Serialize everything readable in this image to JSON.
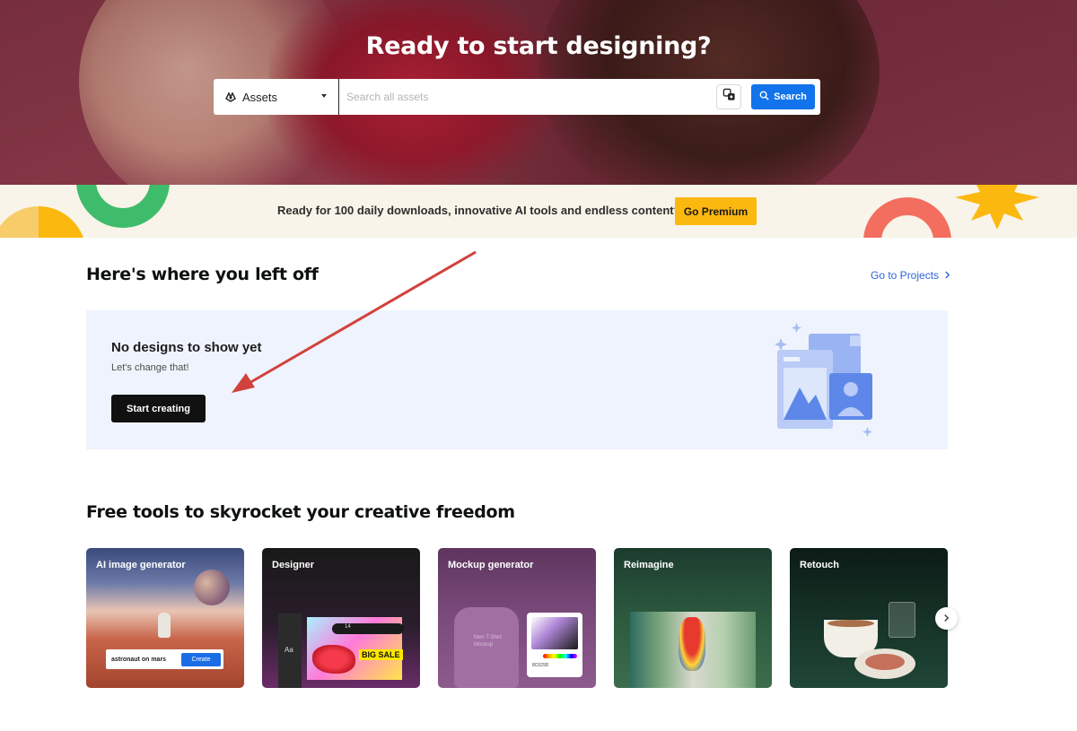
{
  "hero": {
    "title": "Ready to start designing?",
    "search": {
      "category_label": "Assets",
      "placeholder": "Search all assets",
      "value": "",
      "button_label": "Search"
    }
  },
  "premium_banner": {
    "text": "Ready for 100 daily downloads, innovative AI tools and endless content?",
    "button_label": "Go Premium",
    "accent_color": "#fbb80f"
  },
  "left_off": {
    "title": "Here's where you left off",
    "link_label": "Go to Projects",
    "empty_title": "No designs to show yet",
    "empty_subtitle": "Let's change that!",
    "cta_label": "Start creating"
  },
  "tools": {
    "title": "Free tools to skyrocket your creative freedom",
    "items": [
      {
        "label": "AI image generator",
        "prompt_text": "astronaut on mars",
        "prompt_button": "Create"
      },
      {
        "label": "Designer",
        "font_size": "14",
        "badge": "BIG SALE",
        "panel_text": "Aa"
      },
      {
        "label": "Mockup generator",
        "shirt_text": "Men T-Shirt Mockup",
        "hex": "8C629D"
      },
      {
        "label": "Reimagine"
      },
      {
        "label": "Retouch"
      }
    ]
  },
  "colors": {
    "primary_blue": "#1273eb",
    "link_blue": "#2b66d9",
    "dark_button": "#111111",
    "empty_card_bg": "#eef3fd"
  },
  "icons": {
    "asset_select": "assets-icon",
    "image_search": "image-search-icon",
    "search": "search-icon",
    "go_projects": "chevron-right-icon",
    "carousel_next": "chevron-right-icon"
  }
}
